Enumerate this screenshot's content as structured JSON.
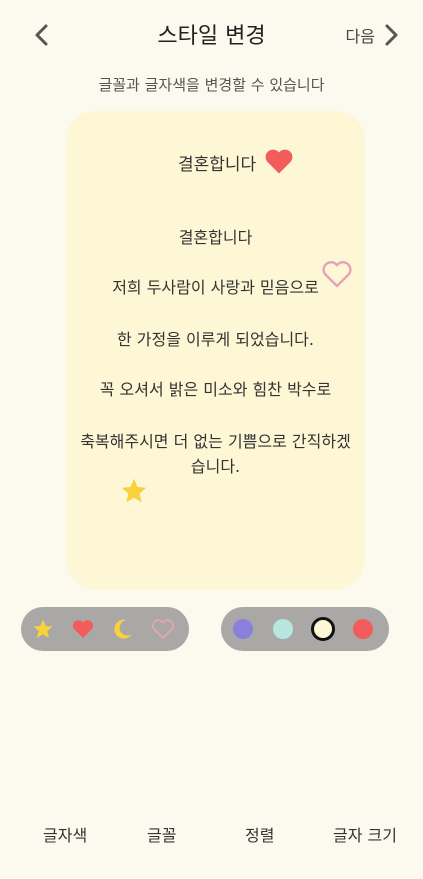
{
  "header": {
    "title": "스타일 변경",
    "next_label": "다음"
  },
  "subtitle": "글꼴과 글자색을 변경할 수 있습니다",
  "card": {
    "title": "결혼합니다",
    "lines": [
      "결혼합니다",
      "저희 두사람이 사랑과 믿음으로",
      "한 가정을 이루게 되었습니다.",
      "꼭 오셔서 밝은 미소와 힘찬 박수로",
      "축복해주시면 더 없는 기쁨으로 간직하겠",
      "습니다."
    ]
  },
  "stickers": [
    "star-icon",
    "heart-icon",
    "moon-icon",
    "outline-heart-icon"
  ],
  "colors": {
    "star": "#f9d13a",
    "heart": "#f25c5c",
    "moon": "#f9d13a",
    "outline_heart": "#e7a3b6",
    "swatches": [
      "#8b7fdc",
      "#b7e6df",
      "#fef7d5",
      "#f25c5c"
    ],
    "selected_swatch": "#fef7d5"
  },
  "bottom_nav": [
    "글자색",
    "글꼴",
    "정렬",
    "글자 크기"
  ]
}
